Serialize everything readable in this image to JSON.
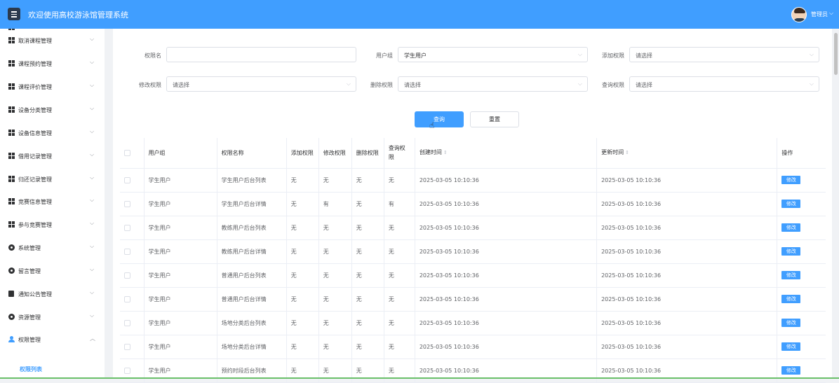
{
  "header": {
    "title": "欢迎使用高校游泳馆管理系统",
    "user_name": "管理员"
  },
  "sidebar": {
    "items": [
      {
        "label": "取消课程管理",
        "icon": "grid-icon"
      },
      {
        "label": "课程预约管理",
        "icon": "grid-icon"
      },
      {
        "label": "课程评价管理",
        "icon": "grid-icon"
      },
      {
        "label": "设备分类管理",
        "icon": "grid-icon"
      },
      {
        "label": "设备信息管理",
        "icon": "grid-icon"
      },
      {
        "label": "借用记录管理",
        "icon": "grid-icon"
      },
      {
        "label": "归还记录管理",
        "icon": "grid-icon"
      },
      {
        "label": "竞赛信息管理",
        "icon": "grid-icon"
      },
      {
        "label": "参与竞赛管理",
        "icon": "grid-icon"
      },
      {
        "label": "系统管理",
        "icon": "gear-icon"
      },
      {
        "label": "留言管理",
        "icon": "gear-icon"
      },
      {
        "label": "通知公告管理",
        "icon": "doc-icon"
      },
      {
        "label": "资源管理",
        "icon": "gear-icon"
      },
      {
        "label": "权限管理",
        "icon": "user-icon"
      }
    ],
    "sub_item": "权限列表"
  },
  "filters": {
    "permission_name": {
      "label": "权限名",
      "value": ""
    },
    "user_group": {
      "label": "用户组",
      "value": "学生用户"
    },
    "add_permission": {
      "label": "添加权限",
      "value": "请选择"
    },
    "edit_permission": {
      "label": "修改权限",
      "value": "请选择"
    },
    "delete_permission": {
      "label": "删除权限",
      "value": "请选择"
    },
    "query_permission": {
      "label": "查询权限",
      "value": "请选择"
    }
  },
  "buttons": {
    "query": "查询",
    "reset": "重置"
  },
  "table": {
    "headers": {
      "user_group": "用户组",
      "permission_name": "权限名称",
      "add": "添加权限",
      "edit": "修改权限",
      "delete": "删除权限",
      "query": "查询权限",
      "created": "创建时间",
      "updated": "更新时间",
      "action": "操作"
    },
    "edit_label": "修改",
    "rows": [
      {
        "group": "学生用户",
        "name": "学生用户后台列表",
        "add": "无",
        "edit": "无",
        "delete": "无",
        "query": "无",
        "created": "2025-03-05 10:10:36",
        "updated": "2025-03-05 10:10:36"
      },
      {
        "group": "学生用户",
        "name": "学生用户后台详情",
        "add": "无",
        "edit": "有",
        "delete": "无",
        "query": "有",
        "created": "2025-03-05 10:10:36",
        "updated": "2025-03-05 10:10:36"
      },
      {
        "group": "学生用户",
        "name": "教练用户后台列表",
        "add": "无",
        "edit": "无",
        "delete": "无",
        "query": "无",
        "created": "2025-03-05 10:10:36",
        "updated": "2025-03-05 10:10:36"
      },
      {
        "group": "学生用户",
        "name": "教练用户后台详情",
        "add": "无",
        "edit": "无",
        "delete": "无",
        "query": "无",
        "created": "2025-03-05 10:10:36",
        "updated": "2025-03-05 10:10:36"
      },
      {
        "group": "学生用户",
        "name": "普通用户后台列表",
        "add": "无",
        "edit": "无",
        "delete": "无",
        "query": "无",
        "created": "2025-03-05 10:10:36",
        "updated": "2025-03-05 10:10:36"
      },
      {
        "group": "学生用户",
        "name": "普通用户后台详情",
        "add": "无",
        "edit": "无",
        "delete": "无",
        "query": "无",
        "created": "2025-03-05 10:10:36",
        "updated": "2025-03-05 10:10:36"
      },
      {
        "group": "学生用户",
        "name": "场地分类后台列表",
        "add": "无",
        "edit": "无",
        "delete": "无",
        "query": "无",
        "created": "2025-03-05 10:10:36",
        "updated": "2025-03-05 10:10:36"
      },
      {
        "group": "学生用户",
        "name": "场地分类后台详情",
        "add": "无",
        "edit": "无",
        "delete": "无",
        "query": "无",
        "created": "2025-03-05 10:10:36",
        "updated": "2025-03-05 10:10:36"
      },
      {
        "group": "学生用户",
        "name": "预约时段后台列表",
        "add": "无",
        "edit": "无",
        "delete": "无",
        "query": "无",
        "created": "2025-03-05 10:10:36",
        "updated": "2025-03-05 10:10:36"
      }
    ]
  }
}
